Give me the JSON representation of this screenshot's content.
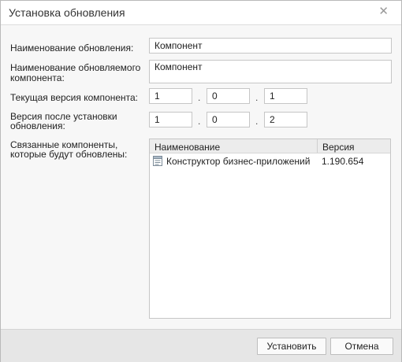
{
  "dialog": {
    "title": "Установка обновления",
    "close_icon": "close-icon"
  },
  "form": {
    "update_name_label": "Наименование обновления:",
    "update_name_value": "Компонент",
    "component_name_label_1": "Наименование обновляемого",
    "component_name_label_2": "компонента:",
    "component_name_value": "Компонент",
    "current_version_label": "Текущая версия компонента:",
    "current_version": [
      "1",
      "0",
      "1"
    ],
    "new_version_label_1": "Версия после установки",
    "new_version_label_2": "обновления:",
    "new_version": [
      "1",
      "0",
      "2"
    ],
    "version_separator": ".",
    "related_label_1": "Связанные компоненты,",
    "related_label_2": "которые будут обновлены:"
  },
  "grid": {
    "columns": [
      "Наименование",
      "Версия"
    ],
    "rows": [
      {
        "icon": "component-icon",
        "name": "Конструктор бизнес-приложений",
        "version": "1.190.654"
      }
    ]
  },
  "footer": {
    "install_label": "Установить",
    "cancel_label": "Отмена"
  }
}
